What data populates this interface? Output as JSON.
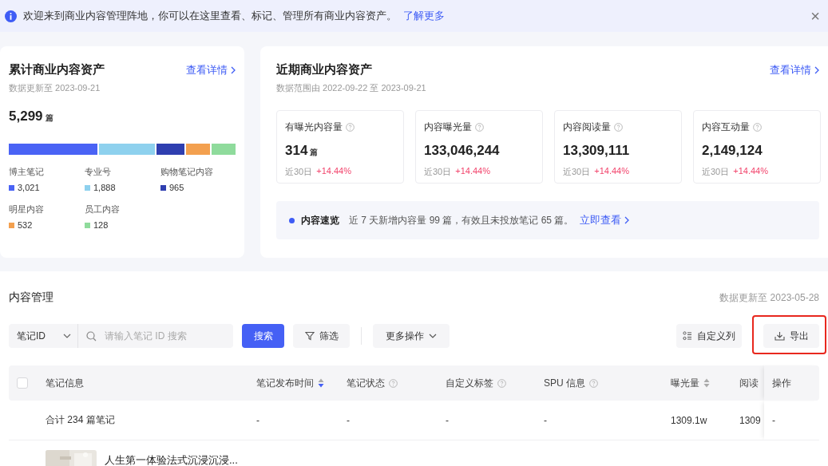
{
  "notice": {
    "text": "欢迎来到商业内容管理阵地，你可以在这里查看、标记、管理所有商业内容资产。",
    "link": "了解更多",
    "close": "×"
  },
  "total_assets": {
    "title": "累计商业内容资产",
    "link": "查看详情",
    "subtitle": "数据更新至 2023-09-21",
    "count": "5,299",
    "unit": "篇",
    "segments": [
      {
        "label": "博主笔记",
        "value": "3,021",
        "color": "#4a63f5"
      },
      {
        "label": "专业号",
        "value": "1,888",
        "color": "#8ed1ee"
      },
      {
        "label": "购物笔记内容",
        "value": "965",
        "color": "#2f3fb0"
      },
      {
        "label": "明星内容",
        "value": "532",
        "color": "#f3a04f"
      },
      {
        "label": "员工内容",
        "value": "128",
        "color": "#8fdb9c"
      }
    ]
  },
  "recent_assets": {
    "title": "近期商业内容资产",
    "link": "查看详情",
    "subtitle": "数据范围由 2022-09-22 至 2023-09-21",
    "metrics": [
      {
        "label": "有曝光内容量",
        "value": "314",
        "unit": "篇",
        "period": "近30日",
        "change": "+14.44%"
      },
      {
        "label": "内容曝光量",
        "value": "133,046,244",
        "period": "近30日",
        "change": "+14.44%"
      },
      {
        "label": "内容阅读量",
        "value": "13,309,111",
        "period": "近30日",
        "change": "+14.44%"
      },
      {
        "label": "内容互动量",
        "value": "2,149,124",
        "period": "近30日",
        "change": "+14.44%"
      }
    ],
    "overview": {
      "label": "内容速览",
      "text": "近 7 天新增内容量 99 篇，有效且未投放笔记 65 篇。",
      "link": "立即查看"
    }
  },
  "content_management": {
    "title": "内容管理",
    "updated": "数据更新至 2023-05-28",
    "toolbar": {
      "field_select": "笔记ID",
      "search_placeholder": "请输入笔记 ID 搜索",
      "search_button": "搜索",
      "filter_button": "筛选",
      "more_button": "更多操作",
      "right_buttons": [
        {
          "kind": "columns",
          "label": "自定义列"
        },
        {
          "kind": "export",
          "label": "导出",
          "highlighted": true
        }
      ]
    },
    "table": {
      "select_all": {
        "checked": false
      },
      "columns": [
        {
          "label": "笔记信息"
        },
        {
          "label": "笔记发布时间",
          "sortable": true,
          "sorted": true
        },
        {
          "label": "笔记状态",
          "help": true
        },
        {
          "label": "自定义标签",
          "help": true
        },
        {
          "label": "SPU 信息",
          "help": true
        },
        {
          "label": "曝光量",
          "sortable": true,
          "sorted": false
        },
        {
          "label": "阅读"
        },
        {
          "label": "操作"
        }
      ],
      "rows": [
        {
          "kind": "summary",
          "cells": [
            "合计 234 篇笔记",
            "-",
            "-",
            "-",
            "-",
            "1309.1w",
            "1309",
            "-"
          ]
        },
        {
          "kind": "note",
          "thumbnail": {
            "kind": "picture"
          },
          "cells": [
            "人生第一体验法式沉浸沉浸..."
          ]
        }
      ]
    }
  }
}
